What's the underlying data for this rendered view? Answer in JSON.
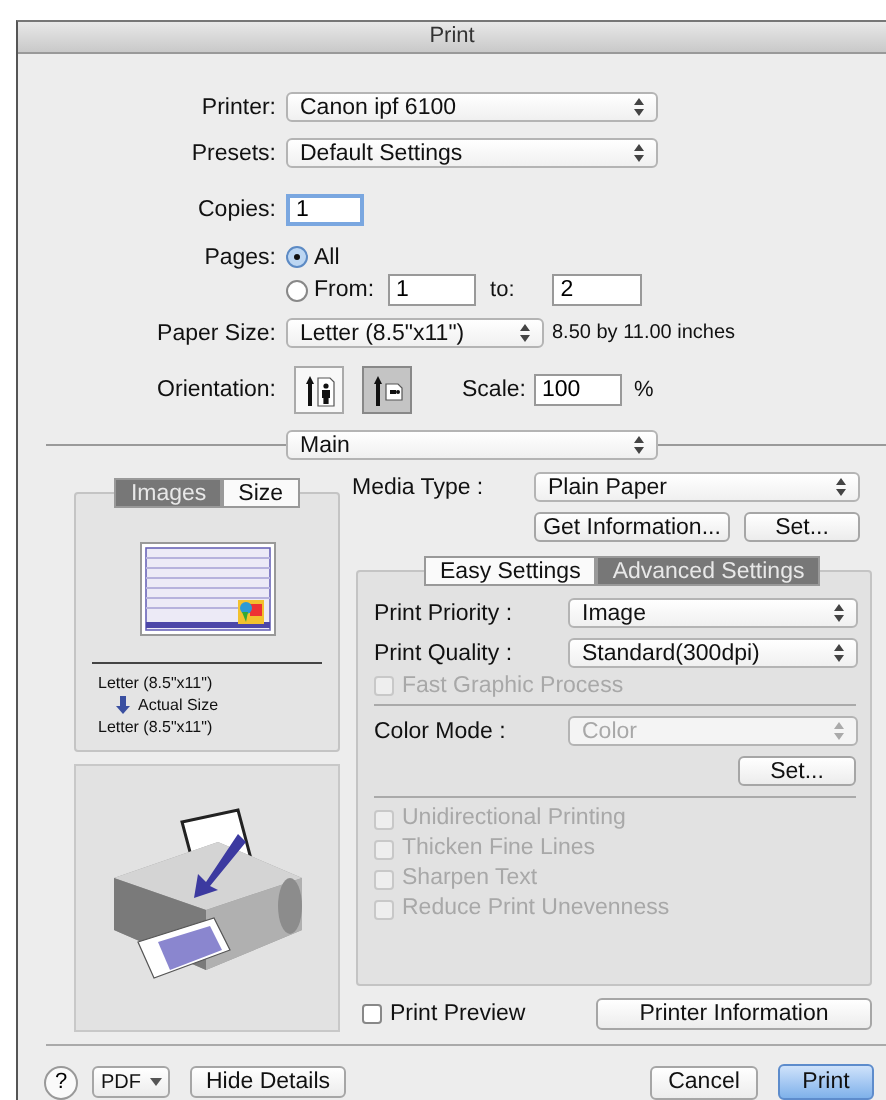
{
  "window": {
    "title": "Print"
  },
  "printer": {
    "label": "Printer:",
    "value": "Canon ipf 6100"
  },
  "presets": {
    "label": "Presets:",
    "value": "Default Settings"
  },
  "copies": {
    "label": "Copies:",
    "value": "1",
    "focused": true
  },
  "pages": {
    "label": "Pages:",
    "options": [
      {
        "label": "All",
        "selected": true
      },
      {
        "label": "From:",
        "selected": false
      }
    ],
    "from": "1",
    "to_label": "to:",
    "to": "2"
  },
  "paper_size": {
    "label": "Paper Size:",
    "value": "Letter (8.5\"x11\")",
    "note": "8.50 by 11.00 inches"
  },
  "orientation": {
    "label": "Orientation:",
    "options": [
      {
        "kind": "portrait",
        "selected": false
      },
      {
        "kind": "landscape",
        "selected": true
      }
    ]
  },
  "scale": {
    "label": "Scale:",
    "value": "100",
    "unit": "%"
  },
  "panel_menu": {
    "value": "Main"
  },
  "preview": {
    "tabs": [
      {
        "label": "Images",
        "selected": true
      },
      {
        "label": "Size",
        "selected": false
      }
    ],
    "source": "Letter (8.5\"x11\")",
    "mode": "Actual Size",
    "target": "Letter (8.5\"x11\")"
  },
  "media_type": {
    "label": "Media Type :",
    "value": "Plain Paper"
  },
  "media_buttons": [
    "Get Information...",
    "Set..."
  ],
  "settings_tabs": [
    {
      "label": "Easy Settings",
      "selected": false
    },
    {
      "label": "Advanced Settings",
      "selected": true
    }
  ],
  "popups": [
    {
      "label": "Print Priority :",
      "value": "Image"
    },
    {
      "label": "Print Quality :",
      "value": "Standard(300dpi)"
    }
  ],
  "fast_graphic": {
    "label": "Fast Graphic Process",
    "checked": false,
    "disabled": true
  },
  "color_mode": {
    "label": "Color Mode :",
    "value": "Color",
    "disabled": true
  },
  "color_set_button": "Set...",
  "options": [
    {
      "label": "Unidirectional Printing",
      "checked": false,
      "disabled": true
    },
    {
      "label": "Thicken Fine Lines",
      "checked": false,
      "disabled": true
    },
    {
      "label": "Sharpen Text",
      "checked": false,
      "disabled": true
    },
    {
      "label": "Reduce Print Unevenness",
      "checked": false,
      "disabled": true
    }
  ],
  "print_preview": {
    "label": "Print Preview",
    "checked": false
  },
  "printer_info_button": "Printer Information",
  "footer": {
    "help": "?",
    "pdf": "PDF",
    "hide_details": "Hide Details",
    "cancel": "Cancel",
    "print": "Print"
  }
}
